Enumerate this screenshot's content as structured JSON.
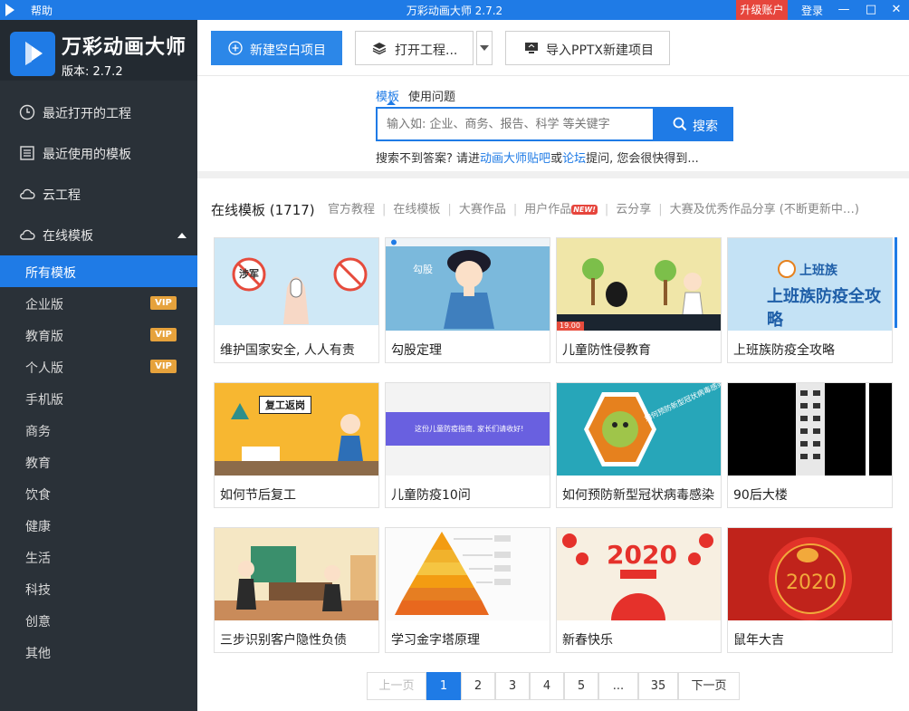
{
  "titlebar": {
    "help": "帮助",
    "title": "万彩动画大师 2.7.2",
    "upgrade": "升级账户",
    "login": "登录"
  },
  "brand": {
    "name": "万彩动画大师",
    "version": "版本: 2.7.2"
  },
  "sidebar": {
    "nav": [
      "最近打开的工程",
      "最近使用的模板",
      "云工程",
      "在线模板"
    ],
    "subs": [
      "所有模板",
      "企业版",
      "教育版",
      "个人版",
      "手机版",
      "商务",
      "教育",
      "饮食",
      "健康",
      "生活",
      "科技",
      "创意",
      "其他"
    ],
    "vip": "VIP"
  },
  "toolbar": {
    "new": "新建空白项目",
    "open": "打开工程...",
    "import": "导入PPTX新建项目"
  },
  "search": {
    "tab_template": "模板",
    "tab_question": "使用问题",
    "placeholder": "输入如: 企业、商务、报告、科学 等关键字",
    "button": "搜索",
    "hint_a": "搜索不到答案? 请进",
    "hint_link1": "动画大师贴吧",
    "hint_b": "或",
    "hint_link2": "论坛",
    "hint_c": "提问, 您会很快得到..."
  },
  "category": {
    "title": "在线模板 (1717)",
    "tabs": [
      "官方教程",
      "在线模板",
      "大赛作品",
      "用户作品",
      "云分享",
      "大赛及优秀作品分享 (不断更新中…)"
    ],
    "new_badge": "NEW!"
  },
  "cards": [
    {
      "title": "维护国家安全, 人人有责",
      "thumb_text": "涉军"
    },
    {
      "title": "勾股定理",
      "thumb_text": "勾股"
    },
    {
      "title": "儿童防性侵教育",
      "thumb_text": "19.00"
    },
    {
      "title": "上班族防疫全攻略",
      "thumb_text": "上班族"
    },
    {
      "title": "如何节后复工",
      "thumb_text": "复工返岗"
    },
    {
      "title": "儿童防疫10问",
      "thumb_text": "这份儿童防疫指南, 家长们请收好!"
    },
    {
      "title": "如何预防新型冠状病毒感染",
      "thumb_text": "如何预防新型冠状病毒感染"
    },
    {
      "title": "90后大楼",
      "thumb_text": ""
    },
    {
      "title": "三步识别客户隐性负债",
      "thumb_text": ""
    },
    {
      "title": "学习金字塔原理",
      "thumb_text": ""
    },
    {
      "title": "新春快乐",
      "thumb_text": "2020"
    },
    {
      "title": "鼠年大吉",
      "thumb_text": "2020"
    }
  ],
  "pager": {
    "prev": "上一页",
    "pages": [
      "1",
      "2",
      "3",
      "4",
      "5",
      "...",
      "35"
    ],
    "next": "下一页",
    "current": "1"
  },
  "colors": {
    "accent": "#1f7be6",
    "sidebar": "#2a3138",
    "upgrade": "#e6453c",
    "vip": "#e6a23c"
  }
}
